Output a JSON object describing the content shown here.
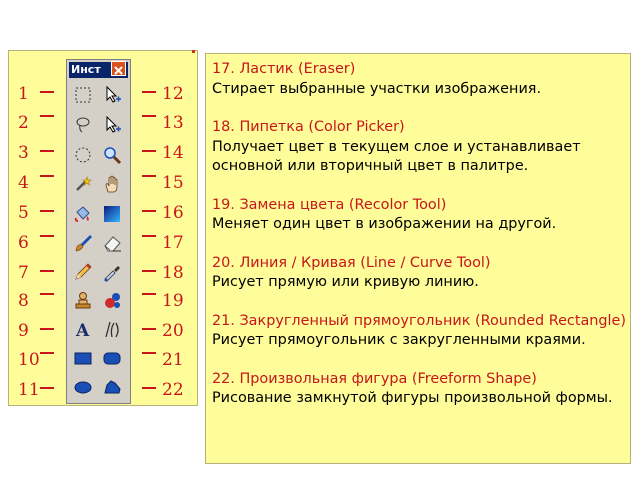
{
  "toolbox": {
    "title": "Инст"
  },
  "left_numbers": [
    "1",
    "2",
    "3",
    "4",
    "5",
    "6",
    "7",
    "8",
    "9",
    "10",
    "11"
  ],
  "right_numbers": [
    "12",
    "13",
    "14",
    "15",
    "16",
    "17",
    "18",
    "19",
    "20",
    "21",
    "22"
  ],
  "tools": [
    [
      "rect-select-icon",
      "move-selection-icon"
    ],
    [
      "lasso-select-icon",
      "move-selected-icon"
    ],
    [
      "ellipse-select-icon",
      "zoom-icon"
    ],
    [
      "magic-wand-icon",
      "pan-hand-icon"
    ],
    [
      "paint-bucket-icon",
      "gradient-icon"
    ],
    [
      "paintbrush-icon",
      "eraser-icon"
    ],
    [
      "pencil-icon",
      "color-picker-icon"
    ],
    [
      "clone-stamp-icon",
      "recolor-icon"
    ],
    [
      "text-icon",
      "line-curve-icon"
    ],
    [
      "rectangle-icon",
      "rounded-rectangle-icon"
    ],
    [
      "ellipse-icon",
      "freeform-shape-icon"
    ]
  ],
  "entries": [
    {
      "title": "17. Ластик (Eraser)",
      "desc": "Стирает выбранные участки изображения."
    },
    {
      "title": "18. Пипетка (Color Picker)",
      "desc": "Получает цвет в текущем слое и устанавливает основной или вторичный цвет в палитре."
    },
    {
      "title": "19. Замена цвета (Recolor Tool)",
      "desc": "Меняет один цвет в изображении на другой."
    },
    {
      "title": "20. Линия / Кривая (Line / Curve Tool)",
      "desc": "Рисует прямую или кривую линию."
    },
    {
      "title": "21. Закругленный прямоугольник (Rounded Rectangle)",
      "desc": "Рисует прямоугольник с закругленными краями."
    },
    {
      "title": "22. Произвольная фигура (Freeform Shape)",
      "desc": "Рисование замкнутой фигуры произвольной формы."
    }
  ],
  "colors": {
    "panel": "#fffd9a",
    "accent_red": "#c8161c",
    "title_bar": "#0a246a",
    "toolbox_gray": "#d4d0c8"
  }
}
